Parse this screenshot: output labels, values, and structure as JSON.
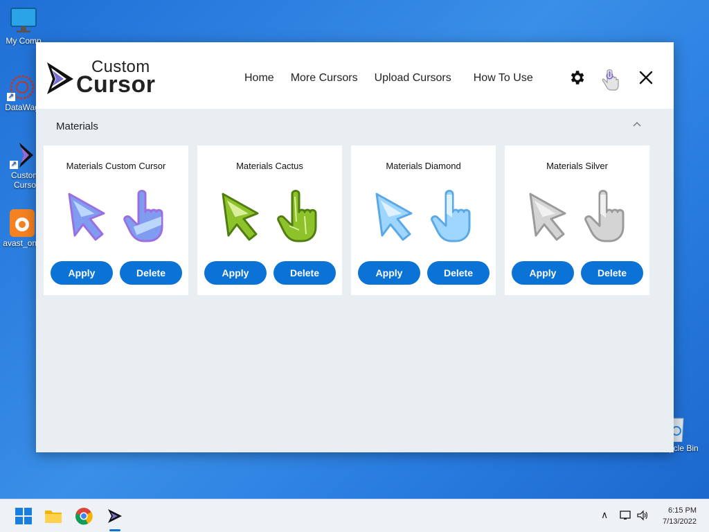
{
  "desktop": {
    "icons": [
      {
        "label": "My Comp"
      },
      {
        "label": "DataWag"
      },
      {
        "label": "Custom Curso"
      },
      {
        "label": "avast_one"
      },
      {
        "label": "Recycle Bin"
      }
    ]
  },
  "app": {
    "logo": {
      "line1": "Custom",
      "line2": "Cursor"
    },
    "nav": [
      "Home",
      "More Cursors",
      "Upload Cursors",
      "How To Use"
    ],
    "section": {
      "title": "Materials"
    },
    "cards": [
      {
        "title": "Materials Custom Cursor",
        "apply": "Apply",
        "delete": "Delete",
        "theme": "purple",
        "colors": [
          "#9b6fe0",
          "#7f9cf0",
          "#c6e2ff"
        ]
      },
      {
        "title": "Materials Cactus",
        "apply": "Apply",
        "delete": "Delete",
        "theme": "cactus",
        "colors": [
          "#4f7d10",
          "#8dc22a",
          "#e8f7b0"
        ]
      },
      {
        "title": "Materials Diamond",
        "apply": "Apply",
        "delete": "Delete",
        "theme": "diamond",
        "colors": [
          "#5aa9e6",
          "#9fd6ff",
          "#e8f6ff"
        ]
      },
      {
        "title": "Materials Silver",
        "apply": "Apply",
        "delete": "Delete",
        "theme": "silver",
        "colors": [
          "#9a9a9a",
          "#d4d4d4",
          "#f6f6f6"
        ]
      }
    ],
    "accent": "#0b73d6"
  },
  "taskbar": {
    "time": "6:15 PM",
    "date": "7/13/2022"
  }
}
